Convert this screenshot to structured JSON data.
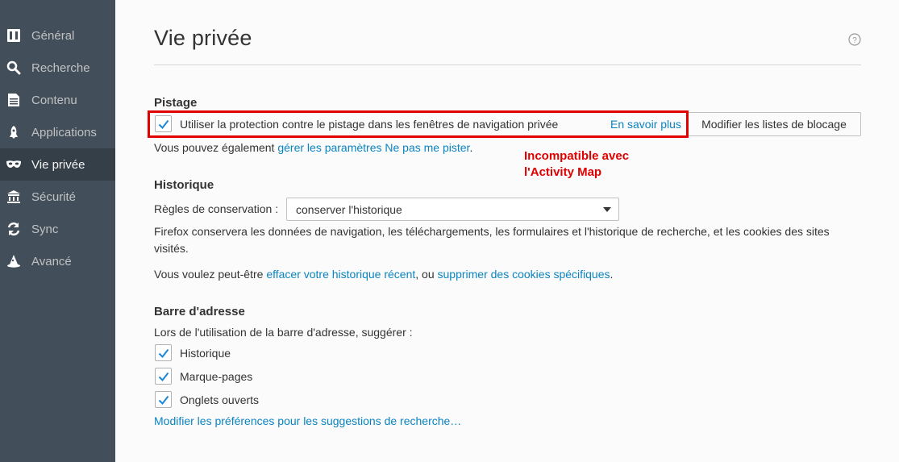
{
  "sidebar": {
    "items": [
      {
        "label": "Général",
        "icon": "general-icon"
      },
      {
        "label": "Recherche",
        "icon": "search-icon"
      },
      {
        "label": "Contenu",
        "icon": "content-icon"
      },
      {
        "label": "Applications",
        "icon": "rocket-icon"
      },
      {
        "label": "Vie privée",
        "icon": "mask-icon",
        "active": true
      },
      {
        "label": "Sécurité",
        "icon": "security-icon"
      },
      {
        "label": "Sync",
        "icon": "sync-icon"
      },
      {
        "label": "Avancé",
        "icon": "wizard-hat-icon"
      }
    ]
  },
  "page": {
    "title": "Vie privée",
    "help_icon": "help-icon"
  },
  "tracking": {
    "heading": "Pistage",
    "checkbox_label": "Utiliser la protection contre le pistage dans les fenêtres de navigation privée",
    "checkbox_checked": true,
    "learn_more": "En savoir plus",
    "block_lists_button": "Modifier les listes de blocage",
    "dnt_prefix": "Vous pouvez également ",
    "dnt_link": "gérer les paramètres Ne pas me pister",
    "dnt_suffix": "."
  },
  "annotation": {
    "line1": "Incompatible avec",
    "line2": "l'Activity Map",
    "color": "#e00000"
  },
  "history": {
    "heading": "Historique",
    "rules_label": "Règles de conservation :",
    "rules_value": "conserver l'historique",
    "description_line1": "Firefox conservera les données de navigation, les téléchargements, les formulaires et l'historique de recherche, et les cookies des sites",
    "description_line2": "visités.",
    "maybe_prefix": "Vous voulez peut-être ",
    "clear_link": "effacer votre historique récent",
    "maybe_middle": ", ou ",
    "cookies_link": "supprimer des cookies spécifiques",
    "maybe_suffix": "."
  },
  "address_bar": {
    "heading": "Barre d'adresse",
    "intro": "Lors de l'utilisation de la barre d'adresse, suggérer :",
    "options": [
      {
        "label": "Historique",
        "checked": true
      },
      {
        "label": "Marque-pages",
        "checked": true
      },
      {
        "label": "Onglets ouverts",
        "checked": true
      }
    ],
    "search_prefs_link": "Modifier les préférences pour les suggestions de recherche…"
  },
  "colors": {
    "sidebar_bg": "#424f5a",
    "sidebar_active": "#343f48",
    "link": "#0a84c1",
    "checkmark": "#1a87d6"
  }
}
